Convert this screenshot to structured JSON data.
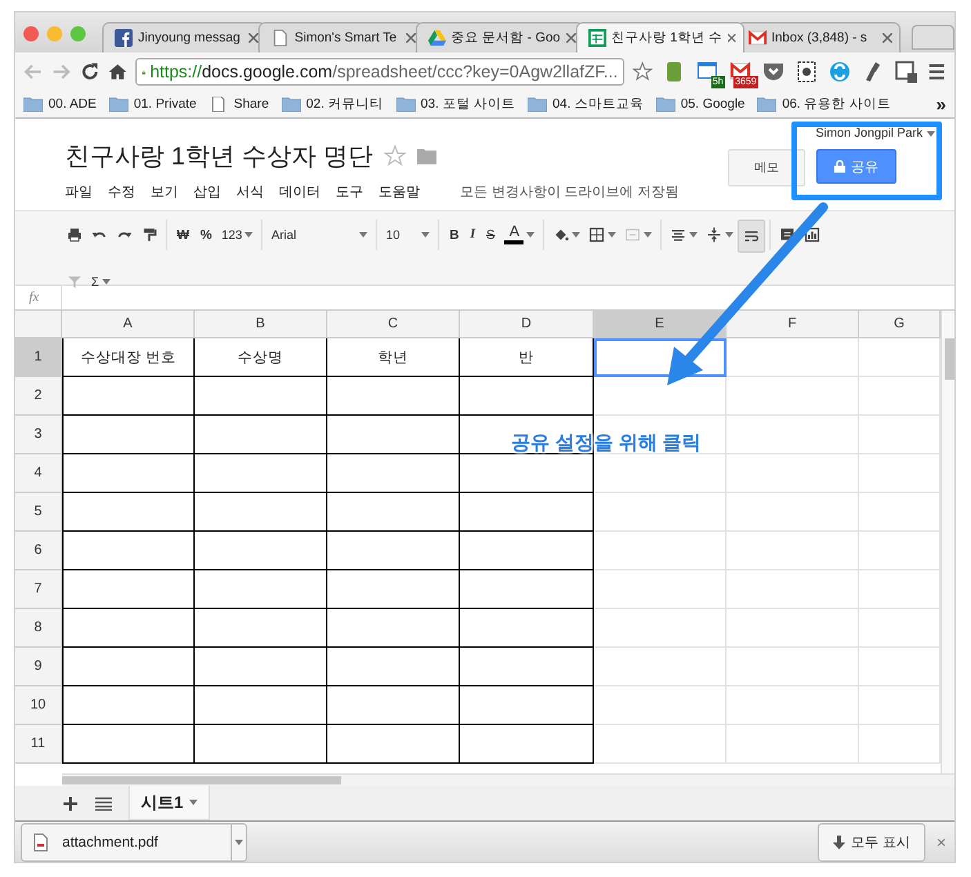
{
  "browser": {
    "tabs": [
      {
        "title": "Jinyoung messag",
        "kind": "facebook",
        "selected": false
      },
      {
        "title": "Simon's Smart Te",
        "kind": "page",
        "selected": false
      },
      {
        "title": "중요 문서함 - Goo",
        "kind": "drive",
        "selected": false
      },
      {
        "title": "친구사랑 1학년 수",
        "kind": "sheets",
        "selected": true
      },
      {
        "title": "Inbox (3,848) - s",
        "kind": "gmail",
        "selected": false
      }
    ],
    "url": {
      "scheme": "https://",
      "host": "docs.google.com",
      "path": "/spreadsheet/ccc?key=0Agw2llafZF..."
    },
    "extensions": [
      {
        "kind": "green"
      },
      {
        "kind": "calendar",
        "badge": "5h"
      },
      {
        "kind": "mail",
        "badge": "3659"
      },
      {
        "kind": "pocket"
      },
      {
        "kind": "evernote"
      },
      {
        "kind": "blue"
      },
      {
        "kind": "pen"
      },
      {
        "kind": "square"
      }
    ],
    "bookmarks": [
      {
        "label": "00. ADE",
        "kind": "folder"
      },
      {
        "label": "01. Private",
        "kind": "folder"
      },
      {
        "label": "Share",
        "kind": "page"
      },
      {
        "label": "02. 커뮤니티",
        "kind": "folder"
      },
      {
        "label": "03. 포털 사이트",
        "kind": "folder"
      },
      {
        "label": "04. 스마트교육",
        "kind": "folder"
      },
      {
        "label": "05. Google",
        "kind": "folder"
      },
      {
        "label": "06. 유용한 사이트",
        "kind": "folder"
      }
    ],
    "more_bookmarks": "»"
  },
  "document": {
    "title": "친구사랑 1학년 수상자 명단",
    "user": "Simon Jongpil Park",
    "memo_button": "메모",
    "share_button": "공유",
    "menus": [
      "파일",
      "수정",
      "보기",
      "삽입",
      "서식",
      "데이터",
      "도구",
      "도움말"
    ],
    "save_status": "모든 변경사항이 드라이브에 저장됨"
  },
  "toolbar": [
    {
      "kind": "print"
    },
    {
      "kind": "undo"
    },
    {
      "kind": "redo"
    },
    {
      "kind": "paint"
    },
    {
      "kind": "sep"
    },
    {
      "kind": "text",
      "label": "₩"
    },
    {
      "kind": "text",
      "label": "%"
    },
    {
      "kind": "drop",
      "label": "123"
    },
    {
      "kind": "sep"
    },
    {
      "kind": "font",
      "label": "Arial"
    },
    {
      "kind": "sep"
    },
    {
      "kind": "size",
      "label": "10"
    },
    {
      "kind": "sep"
    },
    {
      "kind": "bold",
      "label": "B"
    },
    {
      "kind": "italic",
      "label": "I"
    },
    {
      "kind": "strike",
      "label": "S"
    },
    {
      "kind": "color",
      "label": "A"
    },
    {
      "kind": "sep"
    },
    {
      "kind": "fill"
    },
    {
      "kind": "borders"
    },
    {
      "kind": "merge"
    },
    {
      "kind": "sep"
    },
    {
      "kind": "align"
    },
    {
      "kind": "valign"
    },
    {
      "kind": "wrap"
    },
    {
      "kind": "sep"
    },
    {
      "kind": "comment"
    },
    {
      "kind": "chart"
    },
    {
      "kind": "break"
    },
    {
      "kind": "filter"
    },
    {
      "kind": "drop",
      "label": "Σ"
    }
  ],
  "formula_bar": {
    "label": "fx"
  },
  "sheet": {
    "columns": [
      {
        "label": "A",
        "bordered": true,
        "selected": false
      },
      {
        "label": "B",
        "bordered": true,
        "selected": false
      },
      {
        "label": "C",
        "bordered": true,
        "selected": false
      },
      {
        "label": "D",
        "bordered": true,
        "selected": false
      },
      {
        "label": "E",
        "bordered": false,
        "selected": true
      },
      {
        "label": "F",
        "bordered": false,
        "selected": false
      },
      {
        "label": "G",
        "bordered": false,
        "selected": false
      }
    ],
    "rows": [
      {
        "label": "1",
        "selected": true,
        "cells": [
          "수상대장 번호",
          "수상명",
          "학년",
          "반"
        ]
      },
      {
        "label": "2",
        "selected": false
      },
      {
        "label": "3",
        "selected": false
      },
      {
        "label": "4",
        "selected": false
      },
      {
        "label": "5",
        "selected": false
      },
      {
        "label": "6",
        "selected": false
      },
      {
        "label": "7",
        "selected": false
      },
      {
        "label": "8",
        "selected": false
      },
      {
        "label": "9",
        "selected": false
      },
      {
        "label": "10",
        "selected": false
      },
      {
        "label": "11",
        "selected": false
      }
    ],
    "sheet_tabs": [
      {
        "label": "시트1",
        "selected": true
      }
    ]
  },
  "download_bar": {
    "file": "attachment.pdf",
    "show_all": "모두 표시",
    "close": "×"
  },
  "annotation": {
    "text": "공유 설정을 위해 클릭"
  }
}
